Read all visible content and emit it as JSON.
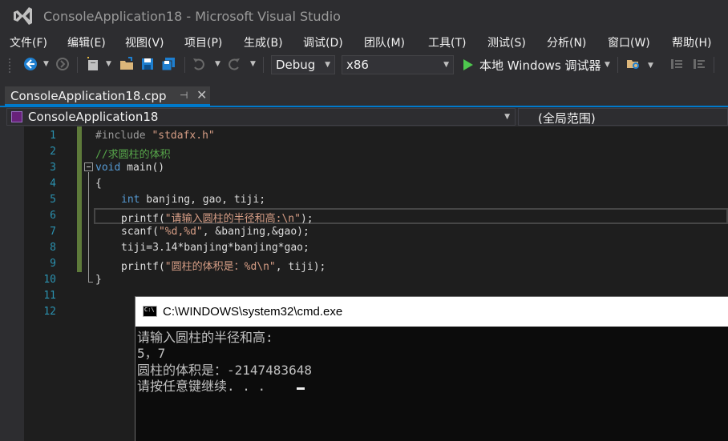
{
  "window": {
    "title": "ConsoleApplication18 - Microsoft Visual Studio"
  },
  "menu": [
    {
      "label": "文件(F)"
    },
    {
      "label": "编辑(E)"
    },
    {
      "label": "视图(V)"
    },
    {
      "label": "项目(P)"
    },
    {
      "label": "生成(B)"
    },
    {
      "label": "调试(D)"
    },
    {
      "label": "团队(M)"
    },
    {
      "label": "工具(T)"
    },
    {
      "label": "测试(S)"
    },
    {
      "label": "分析(N)"
    },
    {
      "label": "窗口(W)"
    },
    {
      "label": "帮助(H)"
    }
  ],
  "toolbar": {
    "configuration": "Debug",
    "platform": "x86",
    "run_label": "本地 Windows 调试器"
  },
  "tab": {
    "label": "ConsoleApplication18.cpp",
    "pin": "⊣",
    "close": "✕"
  },
  "nav": {
    "project": "ConsoleApplication18",
    "scope": "(全局范围)"
  },
  "editor": {
    "line_numbers": [
      "1",
      "2",
      "3",
      "4",
      "5",
      "6",
      "7",
      "8",
      "9",
      "10",
      "11",
      "12"
    ],
    "code": {
      "l1_pp": "#include ",
      "l1_str": "\"stdafx.h\"",
      "l2_cmt": "//求圆柱的体积",
      "l3_kw": "void",
      "l3_rest": " main()",
      "l4": "{",
      "l5_kw": "int",
      "l5_rest": " banjing, gao, tiji;",
      "l6_a": "printf(",
      "l6_str": "\"请输入圆柱的半径和高:\\n\"",
      "l6_b": ");",
      "l7_a": "scanf(",
      "l7_str": "\"%d,%d\"",
      "l7_b": ", &banjing,&gao);",
      "l8": "tiji=3.14*banjing*banjing*gao;",
      "l9_a": "printf(",
      "l9_str": "\"圆柱的体积是：%d\\n\"",
      "l9_b": ", tiji);",
      "l10": "}"
    }
  },
  "console": {
    "title": "C:\\WINDOWS\\system32\\cmd.exe",
    "icon_text": "C:\\",
    "lines": [
      "请输入圆柱的半径和高:",
      "5，7",
      "圆柱的体积是：-2147483648",
      "请按任意键继续. . ."
    ]
  },
  "colors": {
    "background": "#2d2d30",
    "editor": "#1e1e1e",
    "accent": "#007acc",
    "keyword": "#569cd6",
    "string": "#d69d85",
    "comment": "#57a64a",
    "line_number": "#2b91af"
  }
}
